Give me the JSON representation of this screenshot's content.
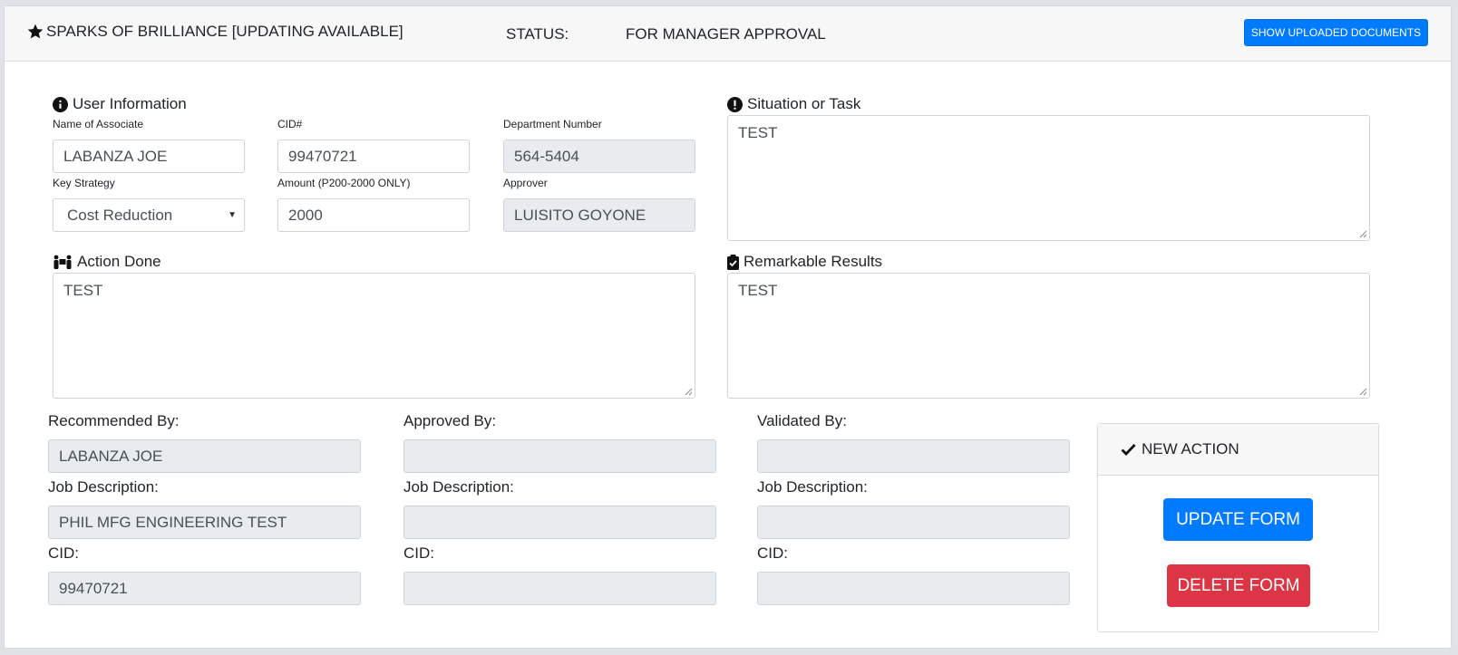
{
  "header": {
    "title": "SPARKS OF BRILLIANCE [UPDATING AVAILABLE]",
    "status_label": "STATUS:",
    "status_value": "FOR MANAGER APPROVAL",
    "show_docs_label": "SHOW UPLOADED DOCUMENTS"
  },
  "user_info": {
    "title": "User Information",
    "name_label": "Name of Associate",
    "name_value": "LABANZA JOE",
    "cid_label": "CID#",
    "cid_value": "99470721",
    "dept_label": "Department Number",
    "dept_value": "564-5404",
    "strategy_label": "Key Strategy",
    "strategy_value": "Cost Reduction",
    "amount_label": "Amount (P200-2000 ONLY)",
    "amount_value": "2000",
    "approver_label": "Approver",
    "approver_value": "LUISITO GOYONE"
  },
  "situation": {
    "title": "Situation or Task",
    "value": "TEST"
  },
  "action_done": {
    "title": "Action Done",
    "value": "TEST"
  },
  "results": {
    "title": "Remarkable Results",
    "value": "TEST"
  },
  "recommended": {
    "label": "Recommended By:",
    "value": "LABANZA JOE",
    "job_label": "Job Description:",
    "job_value": "PHIL MFG ENGINEERING TEST",
    "cid_label": "CID:",
    "cid_value": "99470721"
  },
  "approved": {
    "label": "Approved By:",
    "value": "",
    "job_label": "Job Description:",
    "job_value": "",
    "cid_label": "CID:",
    "cid_value": ""
  },
  "validated": {
    "label": "Validated By:",
    "value": "",
    "job_label": "Job Description:",
    "job_value": "",
    "cid_label": "CID:",
    "cid_value": ""
  },
  "new_action": {
    "title": "NEW ACTION",
    "update_label": "UPDATE FORM",
    "delete_label": "DELETE FORM"
  },
  "colors": {
    "primary": "#007bff",
    "danger": "#dc3545",
    "readonly_bg": "#e9ecef"
  }
}
